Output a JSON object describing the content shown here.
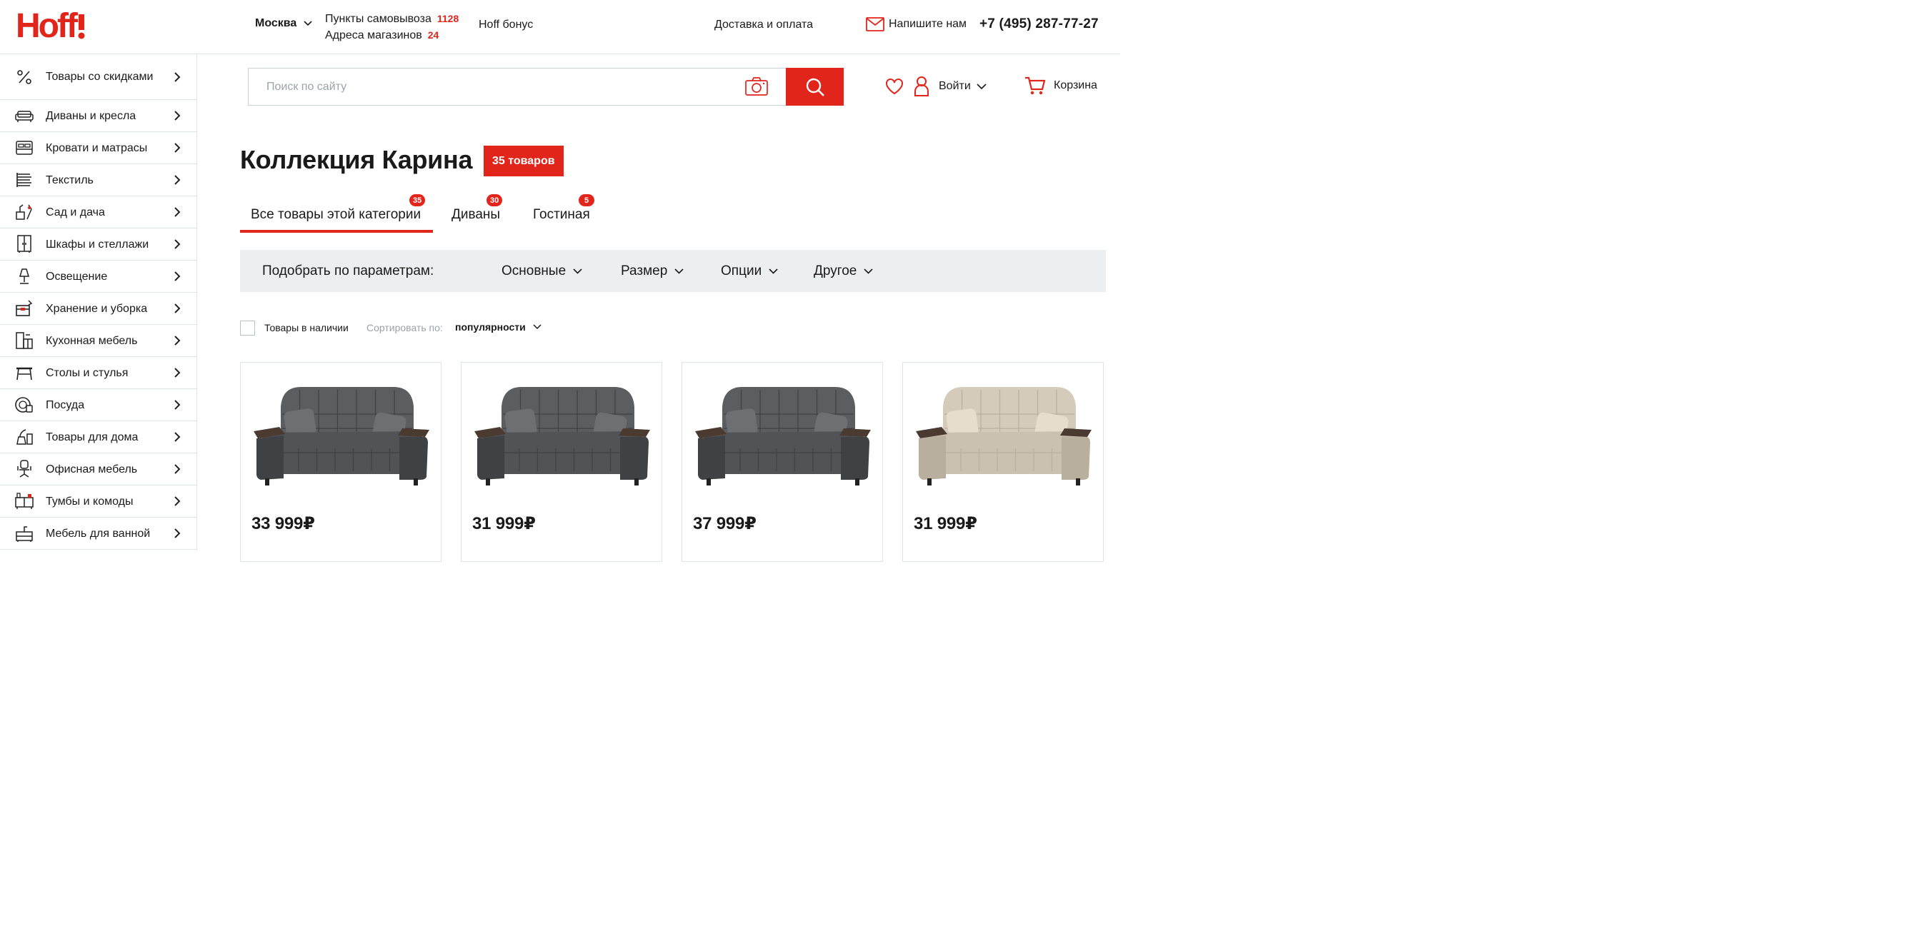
{
  "header": {
    "logo_text": "Hoff",
    "city": "Москва",
    "pickup_label": "Пункты самовывоза",
    "pickup_count": "1128",
    "stores_label": "Адреса магазинов",
    "stores_count": "24",
    "bonus": "Hoff бонус",
    "delivery": "Доставка и оплата",
    "write_us": "Напишите нам",
    "phone": "+7 (495) 287-77-27",
    "brand_color": "#e1251b"
  },
  "sidebar": {
    "items": [
      {
        "label": "Товары со скидками",
        "icon": "percent-icon"
      },
      {
        "label": "Диваны и кресла",
        "icon": "sofa-icon"
      },
      {
        "label": "Кровати и матрасы",
        "icon": "bed-icon"
      },
      {
        "label": "Текстиль",
        "icon": "textile-icon"
      },
      {
        "label": "Сад и дача",
        "icon": "garden-icon"
      },
      {
        "label": "Шкафы и стеллажи",
        "icon": "wardrobe-icon"
      },
      {
        "label": "Освещение",
        "icon": "lamp-icon"
      },
      {
        "label": "Хранение и уборка",
        "icon": "storage-icon"
      },
      {
        "label": "Кухонная мебель",
        "icon": "kitchen-icon"
      },
      {
        "label": "Столы и стулья",
        "icon": "table-icon"
      },
      {
        "label": "Посуда",
        "icon": "dishes-icon"
      },
      {
        "label": "Товары для дома",
        "icon": "home-goods-icon"
      },
      {
        "label": "Офисная мебель",
        "icon": "office-chair-icon"
      },
      {
        "label": "Тумбы и комоды",
        "icon": "dresser-icon"
      },
      {
        "label": "Мебель для ванной",
        "icon": "bathroom-icon"
      }
    ]
  },
  "search": {
    "placeholder": "Поиск по сайту"
  },
  "user": {
    "login": "Войти",
    "cart": "Корзина"
  },
  "main": {
    "title": "Коллекция Карина",
    "count_badge": "35 товаров",
    "tabs": [
      {
        "label": "Все товары этой категории",
        "count": "35",
        "active": true
      },
      {
        "label": "Диваны",
        "count": "30",
        "active": false
      },
      {
        "label": "Гостиная",
        "count": "5",
        "active": false
      }
    ],
    "filters": {
      "label": "Подобрать по параметрам:",
      "dropdowns": [
        "Основные",
        "Размер",
        "Опции",
        "Другое"
      ]
    },
    "in_stock": "Товары в наличии",
    "sort_label": "Сортировать по:",
    "sort_value": "популярности",
    "products": [
      {
        "price": "33 999₽",
        "color": "#5b5d60"
      },
      {
        "price": "31 999₽",
        "color": "#5b5d60"
      },
      {
        "price": "37 999₽",
        "color": "#5b5d60"
      },
      {
        "price": "31 999₽",
        "color": "#d5cbbb"
      }
    ]
  }
}
